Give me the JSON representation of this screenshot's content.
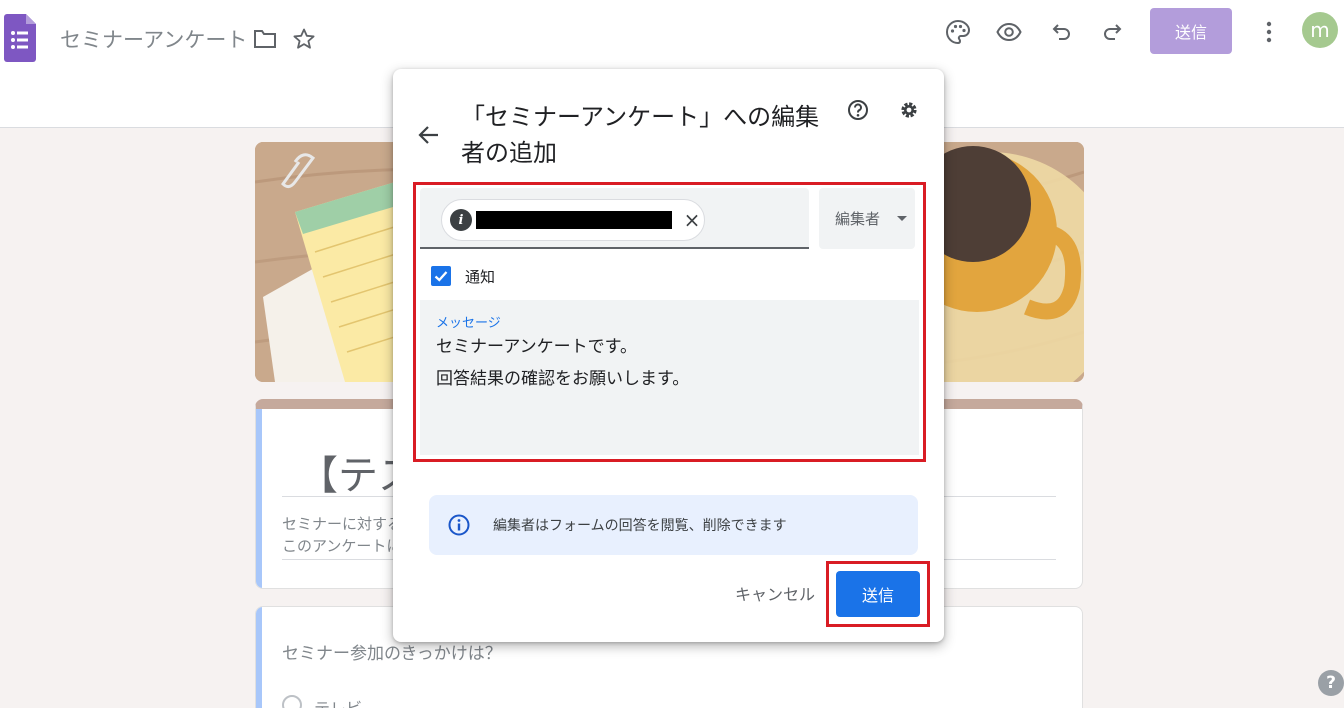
{
  "header": {
    "doc_title": "セミナーアンケート",
    "send_label": "送信",
    "avatar_initial": "m"
  },
  "form": {
    "title_partial": "【テス",
    "description_lines": [
      "セミナーに対する",
      "このアンケートに"
    ],
    "question": "セミナー参加のきっかけは？",
    "option_partial": "テレビ"
  },
  "dialog": {
    "title": "「セミナーアンケート」への編集者の追加",
    "chip_close": "×",
    "role": "編集者",
    "notify_label": "通知",
    "notify_checked": true,
    "message_label": "メッセージ",
    "message_lines": [
      "セミナーアンケートです。",
      "回答結果の確認をお願いします。"
    ],
    "info_text": "編集者はフォームの回答を閲覧、削除できます",
    "cancel_label": "キャンセル",
    "send_label": "送信"
  },
  "colors": {
    "accent_blue": "#1a73e8",
    "highlight_red": "#d91c24",
    "forms_purple": "#7e57c2"
  },
  "help_fab": "?"
}
